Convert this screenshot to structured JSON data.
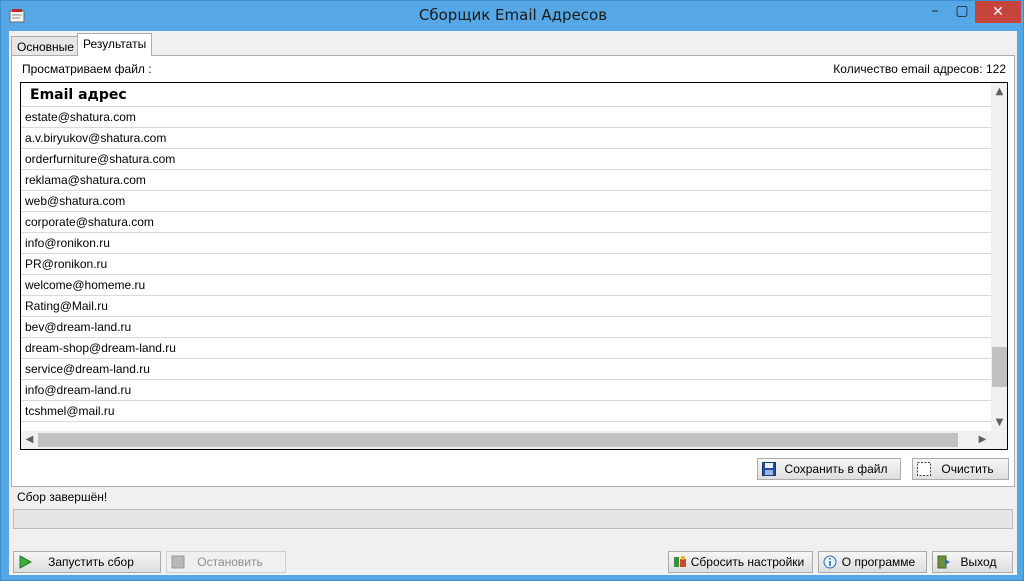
{
  "window": {
    "title": "Сборщик Email Адресов",
    "min_glyph": "–",
    "max_glyph": "▢",
    "close_glyph": "✕"
  },
  "tabs": [
    {
      "label": "Основные",
      "active": false
    },
    {
      "label": "Результаты",
      "active": true
    }
  ],
  "results": {
    "viewing_file_label": "Просматриваем файл :",
    "count_label": "Количество email адресов:",
    "count_value": "122",
    "column_header": "Email адрес",
    "emails": [
      "estate@shatura.com",
      "a.v.biryukov@shatura.com",
      "orderfurniture@shatura.com",
      "reklama@shatura.com",
      "web@shatura.com",
      "corporate@shatura.com",
      "info@ronikon.ru",
      "PR@ronikon.ru",
      "welcome@homeme.ru",
      "Rating@Mail.ru",
      "bev@dream-land.ru",
      "dream-shop@dream-land.ru",
      "service@dream-land.ru",
      "info@dream-land.ru",
      "tcshmel@mail.ru"
    ],
    "save_button": "Сохранить в файл",
    "clear_button": "Очистить"
  },
  "status": {
    "text": "Сбор завершён!",
    "progress": 0
  },
  "bottom_buttons": {
    "start": "Запустить сбор",
    "stop": "Остановить",
    "reset": "Сбросить настройки",
    "about": "О программе",
    "exit": "Выход"
  },
  "colors": {
    "title_bar": "#55a7e6",
    "close_button": "#c7443c",
    "client_bg": "#f0f0f0"
  }
}
